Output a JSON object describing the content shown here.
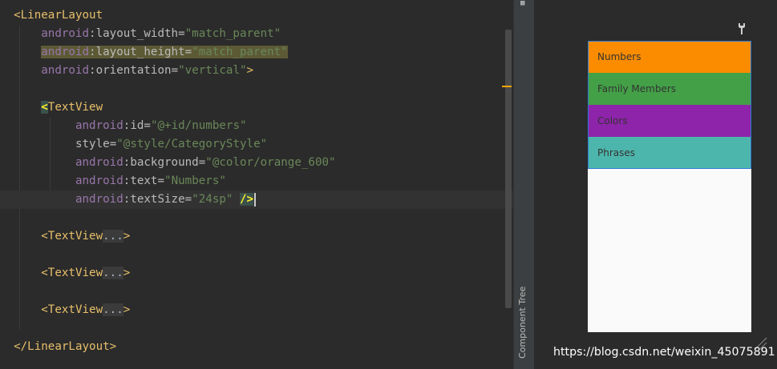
{
  "code": {
    "line1": {
      "lt": "<",
      "tag": "LinearLayout"
    },
    "line2": {
      "ns": "android",
      "colon": ":",
      "attr": "layout_width",
      "eq": "=",
      "val": "\"match_parent\""
    },
    "line3": {
      "ns": "android",
      "colon": ":",
      "attr": "layout_height",
      "eq": "=",
      "val": "\"match_parent\""
    },
    "line4": {
      "ns": "android",
      "colon": ":",
      "attr": "orientation",
      "eq": "=",
      "val": "\"vertical\"",
      "end": ">"
    },
    "line6": {
      "lt": "<",
      "tag": "TextView"
    },
    "line7": {
      "ns": "android",
      "colon": ":",
      "attr": "id",
      "eq": "=",
      "val": "\"@+id/numbers\""
    },
    "line8": {
      "attr": "style",
      "eq": "=",
      "val": "\"@style/CategoryStyle\""
    },
    "line9": {
      "ns": "android",
      "colon": ":",
      "attr": "background",
      "eq": "=",
      "val": "\"@color/orange_600\""
    },
    "line10": {
      "ns": "android",
      "colon": ":",
      "attr": "text",
      "eq": "=",
      "val": "\"Numbers\""
    },
    "line11": {
      "ns": "android",
      "colon": ":",
      "attr": "textSize",
      "eq": "=",
      "val": "\"24sp\"",
      "end": "/>"
    },
    "folded": {
      "open": "<TextView",
      "dots": "...",
      "close": ">"
    },
    "close_root": "</LinearLayout>"
  },
  "side_panel": {
    "label": "Component Tree"
  },
  "preview": {
    "items": [
      {
        "label": "Numbers",
        "color": "#fb8c00"
      },
      {
        "label": "Family Members",
        "color": "#43a047"
      },
      {
        "label": "Colors",
        "color": "#8e24aa"
      },
      {
        "label": "Phrases",
        "color": "#4db6ac"
      }
    ],
    "selection_color": "#2f7bd3"
  },
  "watermark": "https://blog.csdn.net/weixin_45075891"
}
